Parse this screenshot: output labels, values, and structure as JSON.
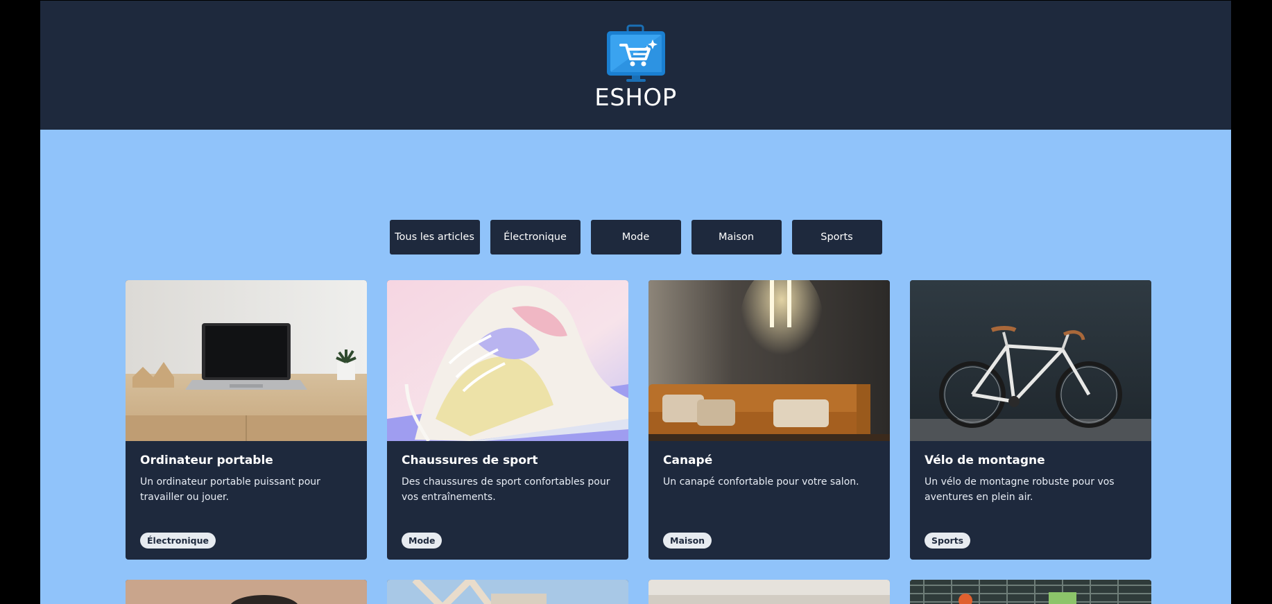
{
  "header": {
    "brand": "ESHOP",
    "logo_icon": "shopping-cart-monitor-icon",
    "background": "#1e293d"
  },
  "page": {
    "background": "#90c3fa"
  },
  "filters": [
    {
      "label": "Tous les articles"
    },
    {
      "label": "Électronique"
    },
    {
      "label": "Mode"
    },
    {
      "label": "Maison"
    },
    {
      "label": "Sports"
    }
  ],
  "products": [
    {
      "title": "Ordinateur portable",
      "description": "Un ordinateur portable puissant pour travailler ou jouer.",
      "category": "Électronique"
    },
    {
      "title": "Chaussures de sport",
      "description": "Des chaussures de sport confortables pour vos entraînements.",
      "category": "Mode"
    },
    {
      "title": "Canapé",
      "description": "Un canapé confortable pour votre salon.",
      "category": "Maison"
    },
    {
      "title": "Vélo de montagne",
      "description": "Un vélo de montagne robuste pour vos aventures en plein air.",
      "category": "Sports"
    }
  ]
}
